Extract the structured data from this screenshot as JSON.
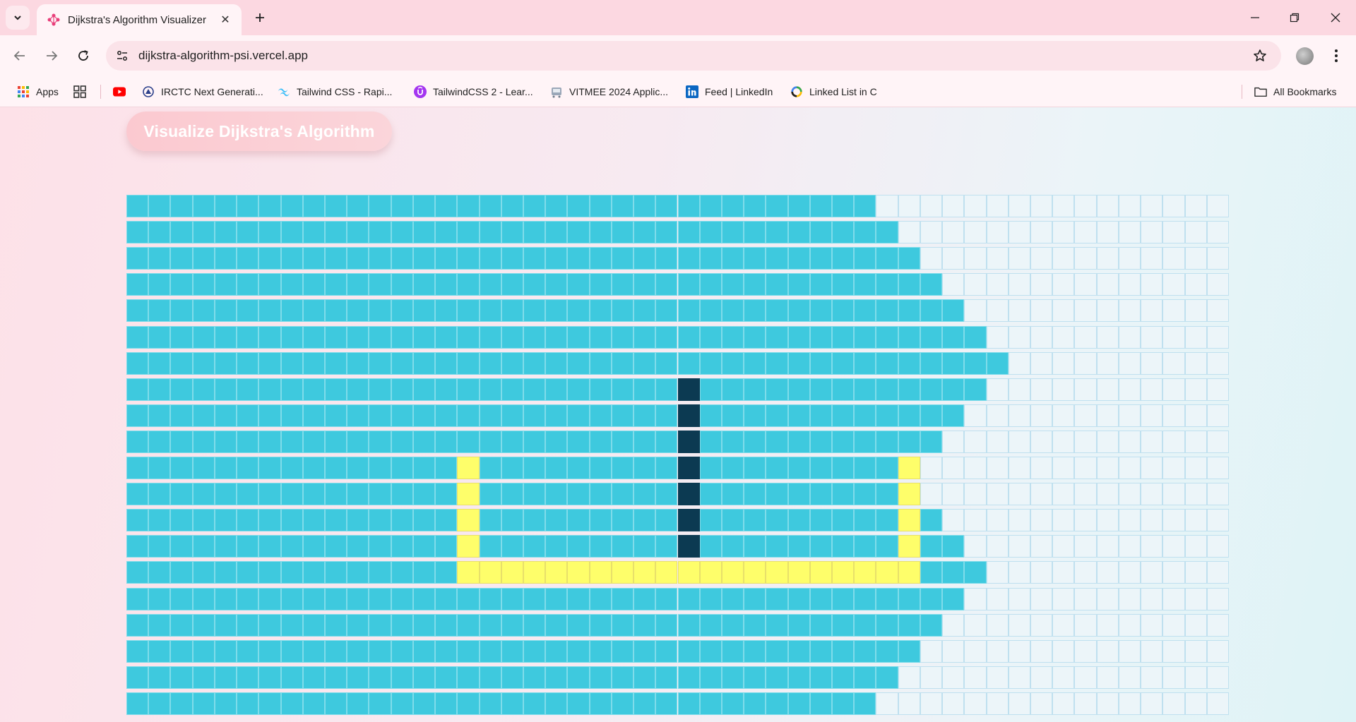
{
  "browser": {
    "tab_title": "Dijkstra's Algorithm Visualizer",
    "url": "dijkstra-algorithm-psi.vercel.app",
    "bookmarks": [
      {
        "label": "Apps",
        "icon": "apps-grid-icon"
      },
      {
        "label": "",
        "icon": "tab-groups-icon"
      },
      {
        "label": "",
        "icon": "youtube-icon",
        "color": "#ff0000"
      },
      {
        "label": "IRCTC Next Generati...",
        "icon": "irctc-icon"
      },
      {
        "label": "Tailwind CSS - Rapi...",
        "icon": "tailwind-icon",
        "color": "#38bdf8"
      },
      {
        "label": "TailwindCSS 2 - Lear...",
        "icon": "udemy-icon",
        "color": "#a435f0"
      },
      {
        "label": "VITMEE 2024 Applic...",
        "icon": "vit-icon"
      },
      {
        "label": "Feed | LinkedIn",
        "icon": "linkedin-icon",
        "color": "#0a66c2"
      },
      {
        "label": "Linked List in C",
        "icon": "circle-logo-icon"
      }
    ],
    "all_bookmarks": "All Bookmarks"
  },
  "page": {
    "button_label": "Visualize Dijkstra's Algorithm"
  },
  "grid": {
    "cols": 50,
    "rows": 20,
    "colors": {
      "visited": "#3ec9de",
      "path": "#fefe6a",
      "wall": "#0c3a52",
      "unvisited": "#ecf5f9"
    },
    "visited_cols_per_row": [
      34,
      35,
      36,
      37,
      38,
      39,
      40,
      39,
      38,
      37,
      36,
      36,
      37,
      38,
      39,
      38,
      37,
      36,
      35,
      34
    ],
    "wall_cells": [
      [
        7,
        25
      ],
      [
        8,
        25
      ],
      [
        9,
        25
      ],
      [
        10,
        25
      ],
      [
        11,
        25
      ],
      [
        12,
        25
      ],
      [
        13,
        25
      ]
    ],
    "path_cells": [
      [
        10,
        15
      ],
      [
        11,
        15
      ],
      [
        12,
        15
      ],
      [
        13,
        15
      ],
      [
        14,
        15
      ],
      [
        14,
        16
      ],
      [
        14,
        17
      ],
      [
        14,
        18
      ],
      [
        14,
        19
      ],
      [
        14,
        20
      ],
      [
        14,
        21
      ],
      [
        14,
        22
      ],
      [
        14,
        23
      ],
      [
        14,
        24
      ],
      [
        14,
        25
      ],
      [
        14,
        26
      ],
      [
        14,
        27
      ],
      [
        14,
        28
      ],
      [
        14,
        29
      ],
      [
        14,
        30
      ],
      [
        14,
        31
      ],
      [
        14,
        32
      ],
      [
        14,
        33
      ],
      [
        14,
        34
      ],
      [
        14,
        35
      ],
      [
        10,
        35
      ],
      [
        11,
        35
      ],
      [
        12,
        35
      ],
      [
        13,
        35
      ]
    ]
  }
}
